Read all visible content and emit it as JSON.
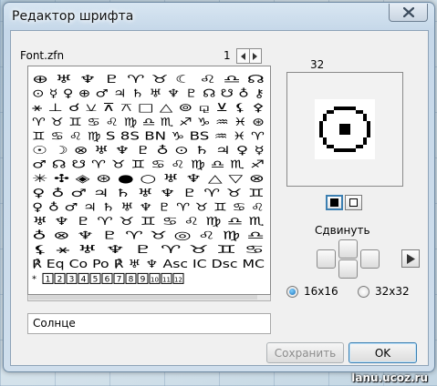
{
  "window": {
    "title": "Редактор шрифта"
  },
  "font_panel": {
    "font_file": "Font.zfn",
    "page_number": "1",
    "glyph_rows": [
      "⊕ ♅ ♆ ♇ ♈ ♉ ☾ ♌ ♎ ☊",
      "⊙ ☿ ♀ ⊕ ♂ ♃ ♄ ♅ ♆ ♇ ☊ ☋ ♁ ⚷",
      "⚹ ⊥ ☌ ⚺ ⊼ ⚻ □ △ ⊚ ⚼ ⊻ ⚸ ⚴",
      "♈ ♉ ♊ ♋ ♌ ♍ ♎ ♏ ♐ ♑ ♒ ♓ ⊛",
      "♊ ♋ ♌ ♍ S 8S BN ♑ BS ♒ ♓ ♈",
      "☉ ☽ ⊗ ♅ ♆ ♇ ♁ ⊙ ♄ ♃ ♀ ☿",
      "♂ ☊ ☋ ♈ ♉ ♊ ♋ ♌ ♍ ♎ ♏ ♐",
      "✳ ✣ ◈ ⊛ ● ○ ♅ ♆ △ ▽ ⊗",
      "♀ ♁ ♂ ♃ ♄ ♅ ♆ ♇ ♈ ♉ ♊",
      "♀ ♁ ♂ ♃ ♄ ♅ ♆ ♇ ♈ ♉ ♊ ♋ ♌",
      "♅ ♆ ♇ ♈ ♉ ♊ ♋ ♌ ♍ ♎ ♏",
      "♁ ⊗ ♆ ♇ ♈ ♉ ◎ ♌ ♍ ♎",
      "⚸ ⚹ ♅ ♆ ♇ ♈ ♉ ♊ ♋",
      "℟ Eq Co Po ℟ ♅ ♆ Asc IC Dsc MC",
      "1 2 3 4 5 6 7 8 9 10 11 12"
    ],
    "glyph_name": "Солнце"
  },
  "preview_panel": {
    "size_label": "32",
    "preview_icon": "sun-symbol-icon"
  },
  "controls": {
    "shift_label": "Сдвинуть",
    "size_options": [
      "16x16",
      "32x32"
    ],
    "selected_size": "16x16"
  },
  "buttons": {
    "save_label": "Сохранить",
    "ok_label": "OK"
  },
  "desktop": {
    "watermark": "lanu.ucoz.ru"
  }
}
